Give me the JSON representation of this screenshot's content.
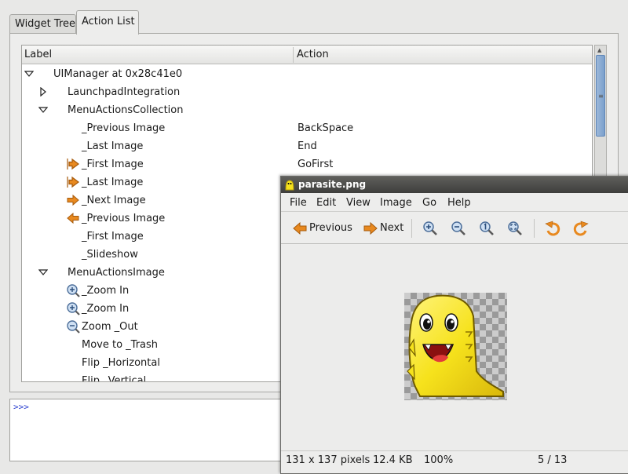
{
  "parasite": {
    "tabs": [
      "Widget Tree",
      "Action List"
    ],
    "columns": {
      "label": "Label",
      "action": "Action"
    },
    "rows": [
      {
        "label": "UIManager at 0x28c41e0",
        "action": "",
        "expander": "expanded",
        "icon": ""
      },
      {
        "label": "LaunchpadIntegration",
        "action": "",
        "expander": "collapsed",
        "icon": ""
      },
      {
        "label": "MenuActionsCollection",
        "action": "",
        "expander": "expanded",
        "icon": ""
      },
      {
        "label": "_Previous Image",
        "action": "BackSpace",
        "expander": "",
        "icon": ""
      },
      {
        "label": "_Last Image",
        "action": "End",
        "expander": "",
        "icon": ""
      },
      {
        "label": "_First Image",
        "action": "GoFirst",
        "expander": "",
        "icon": "go-first-icon"
      },
      {
        "label": "_Last Image",
        "action": "",
        "expander": "",
        "icon": "go-last-icon"
      },
      {
        "label": "_Next Image",
        "action": "",
        "expander": "",
        "icon": "go-next-icon"
      },
      {
        "label": "_Previous Image",
        "action": "",
        "expander": "",
        "icon": "go-previous-icon"
      },
      {
        "label": "_First Image",
        "action": "",
        "expander": "",
        "icon": ""
      },
      {
        "label": "_Slideshow",
        "action": "",
        "expander": "",
        "icon": ""
      },
      {
        "label": "MenuActionsImage",
        "action": "",
        "expander": "expanded",
        "icon": ""
      },
      {
        "label": "_Zoom In",
        "action": "",
        "expander": "",
        "icon": "zoom-in-icon"
      },
      {
        "label": "_Zoom In",
        "action": "",
        "expander": "",
        "icon": "zoom-in-icon"
      },
      {
        "label": "Zoom _Out",
        "action": "",
        "expander": "",
        "icon": "zoom-out-icon"
      },
      {
        "label": "Move to _Trash",
        "action": "",
        "expander": "",
        "icon": ""
      },
      {
        "label": "Flip _Horizontal",
        "action": "",
        "expander": "",
        "icon": ""
      },
      {
        "label": "Flip _Vertical",
        "action": "",
        "expander": "",
        "icon": ""
      }
    ],
    "console_prompt": ">>>"
  },
  "viewer": {
    "title": "parasite.png",
    "menu": [
      "File",
      "Edit",
      "View",
      "Image",
      "Go",
      "Help"
    ],
    "toolbar": {
      "previous": "Previous",
      "next": "Next"
    },
    "status": {
      "dimensions": "131 x 137 pixels",
      "size": "12.4 KB",
      "zoom": "100%",
      "position": "5 / 13"
    }
  },
  "colors": {
    "accent": "#7ba0cc",
    "arrow_orange": "#e8891f",
    "titlebar": "#4a4a48",
    "creature_yellow": "#f6e21c"
  }
}
